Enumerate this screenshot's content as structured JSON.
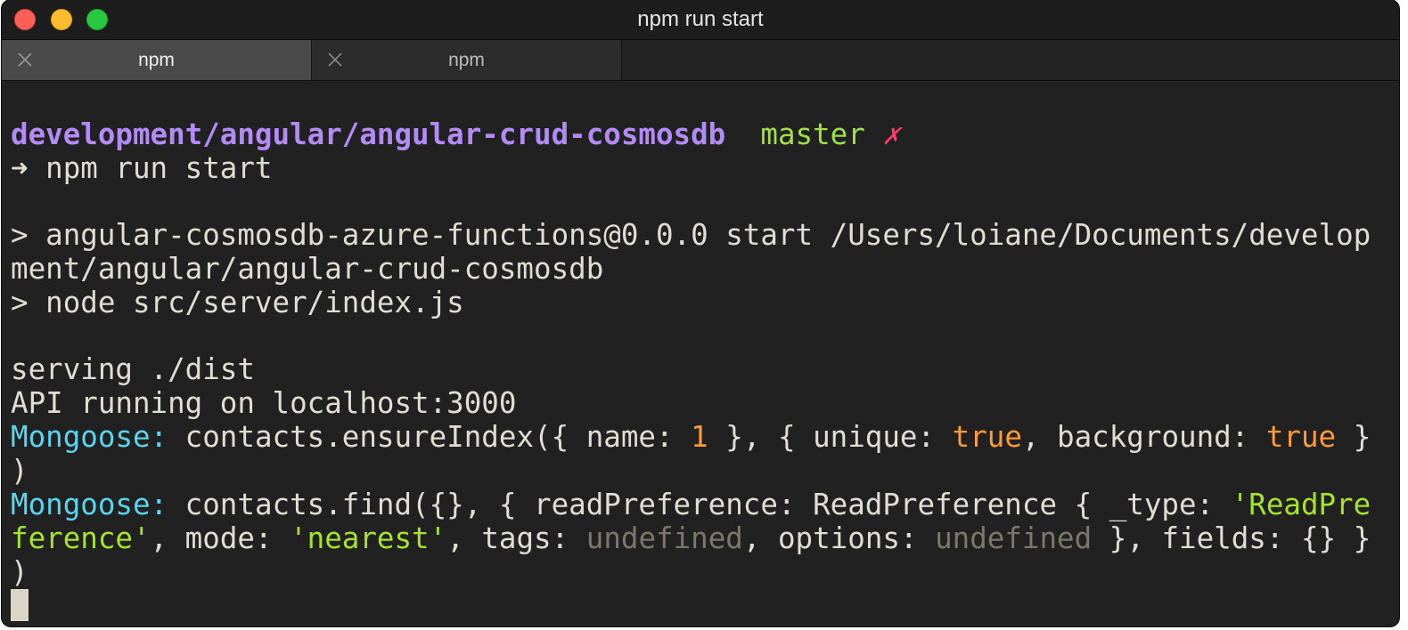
{
  "window": {
    "title": "npm run start"
  },
  "tabs": [
    {
      "label": "npm",
      "active": true
    },
    {
      "label": "npm",
      "active": false
    }
  ],
  "terminal": {
    "prompt": {
      "path": "development/angular/angular-crud-cosmosdb",
      "branch": "master",
      "dirty_mark": "✗"
    },
    "command_line": "➜ npm run start",
    "script_line_1": "> angular-cosmosdb-azure-functions@0.0.0 start /Users/loiane/Documents/develop",
    "script_line_2": "ment/angular/angular-crud-cosmosdb",
    "script_line_3": "> node src/server/index.js",
    "serving": "serving ./dist",
    "api": "API running on localhost:3000",
    "log1": {
      "prefix": "Mongoose:",
      "a": " contacts.ensureIndex({ name: ",
      "num": "1",
      "b": " }, { unique: ",
      "true1": "true",
      "c": ", background: ",
      "true2": "true",
      "d": " }",
      "wrap": ")"
    },
    "log2": {
      "prefix": "Mongoose:",
      "a": " contacts.find({}, { readPreference: ReadPreference { _type: ",
      "str1_part1": "'ReadPre",
      "str1_part2": "ference'",
      "b": ", mode: ",
      "str2": "'nearest'",
      "c": ", tags: ",
      "undef1": "undefined",
      "d": ", options: ",
      "undef2": "undefined",
      "e": " }, fields: {} }",
      "wrap": ")"
    }
  },
  "colors": {
    "path": "#b38bf7",
    "branch": "#9fe046",
    "dirty": "#ff3a6b",
    "mongoose": "#5ad4ec",
    "number": "#fd9a3a",
    "string": "#a6e22e",
    "undefined": "#7b786b",
    "background": "#212121",
    "foreground": "#e0ddd3"
  }
}
